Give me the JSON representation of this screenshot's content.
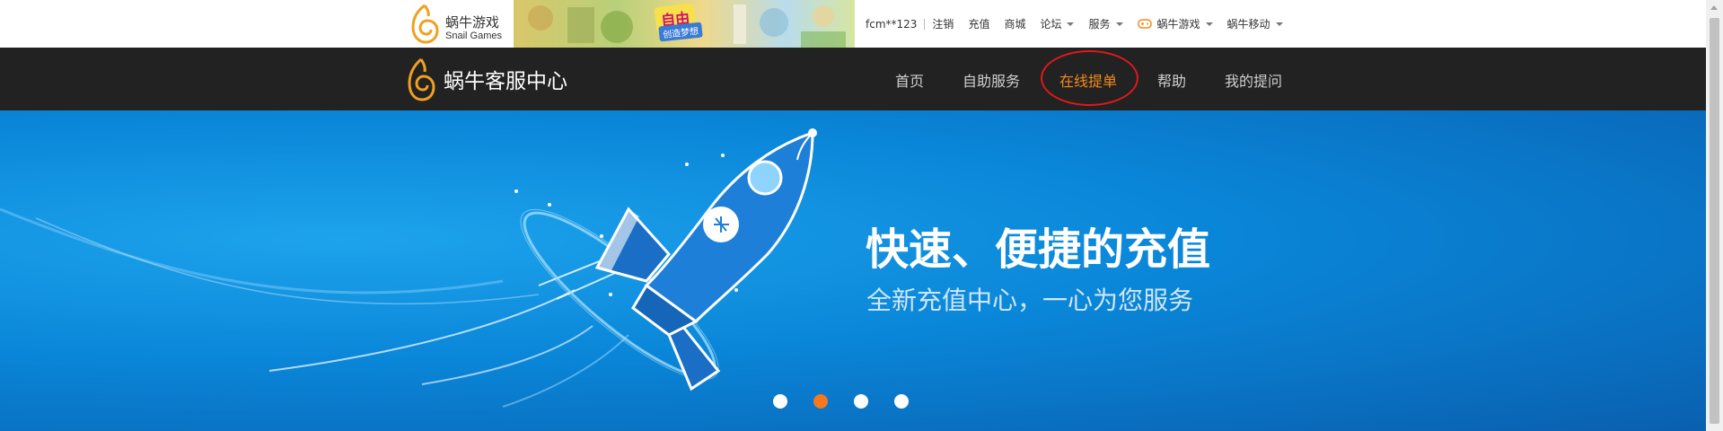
{
  "brand": {
    "name_cn": "蜗牛游戏",
    "name_en": "Snail Games",
    "icon": "snail-spiral-logo"
  },
  "banner": {
    "ad_text": "自由",
    "ad_sub": "创造梦想"
  },
  "topnav": {
    "user": "fcm**123",
    "items": [
      "注销",
      "充值",
      "商城"
    ],
    "dropdowns": [
      "论坛",
      "服务"
    ],
    "games": {
      "label": "蜗牛游戏",
      "icon": "gamepad-icon"
    },
    "mobile": "蜗牛移动"
  },
  "mainnav": {
    "logo_text": "蜗牛客服中心",
    "items": [
      "首页",
      "自助服务",
      "在线提单",
      "帮助",
      "我的提问"
    ],
    "active_index": 2
  },
  "hero": {
    "title": "快速、便捷的充值",
    "subtitle": "全新充值中心，一心为您服务",
    "slides": 4,
    "active_slide": 1
  },
  "colors": {
    "accent": "#f28a1a",
    "nav_bg": "#222222",
    "hero_blue": "#0a86d8",
    "highlight": "#e0191a"
  }
}
